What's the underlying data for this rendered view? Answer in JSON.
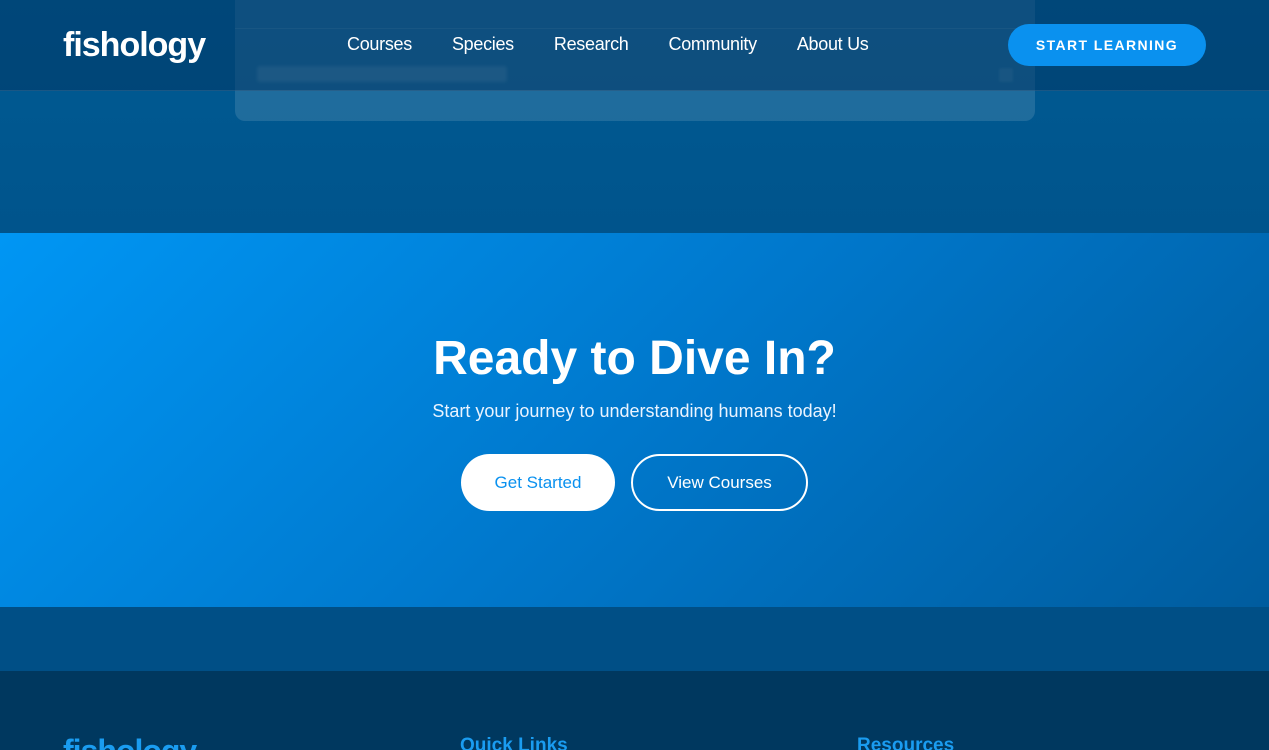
{
  "header": {
    "logo": "fishology",
    "nav": [
      "Courses",
      "Species",
      "Research",
      "Community",
      "About Us"
    ],
    "cta_label": "START LEARNING"
  },
  "cta": {
    "title": "Ready to Dive In?",
    "subtitle": "Start your journey to understanding humans today!",
    "primary_label": "Get Started",
    "secondary_label": "View Courses"
  },
  "footer": {
    "logo": "fishology",
    "headings": [
      "Quick Links",
      "Resources"
    ]
  },
  "colors": {
    "accent": "#0a91ef",
    "header_bg": "#003764",
    "cta_gradient_start": "#0096f4",
    "footer_bg": "#00385f"
  }
}
